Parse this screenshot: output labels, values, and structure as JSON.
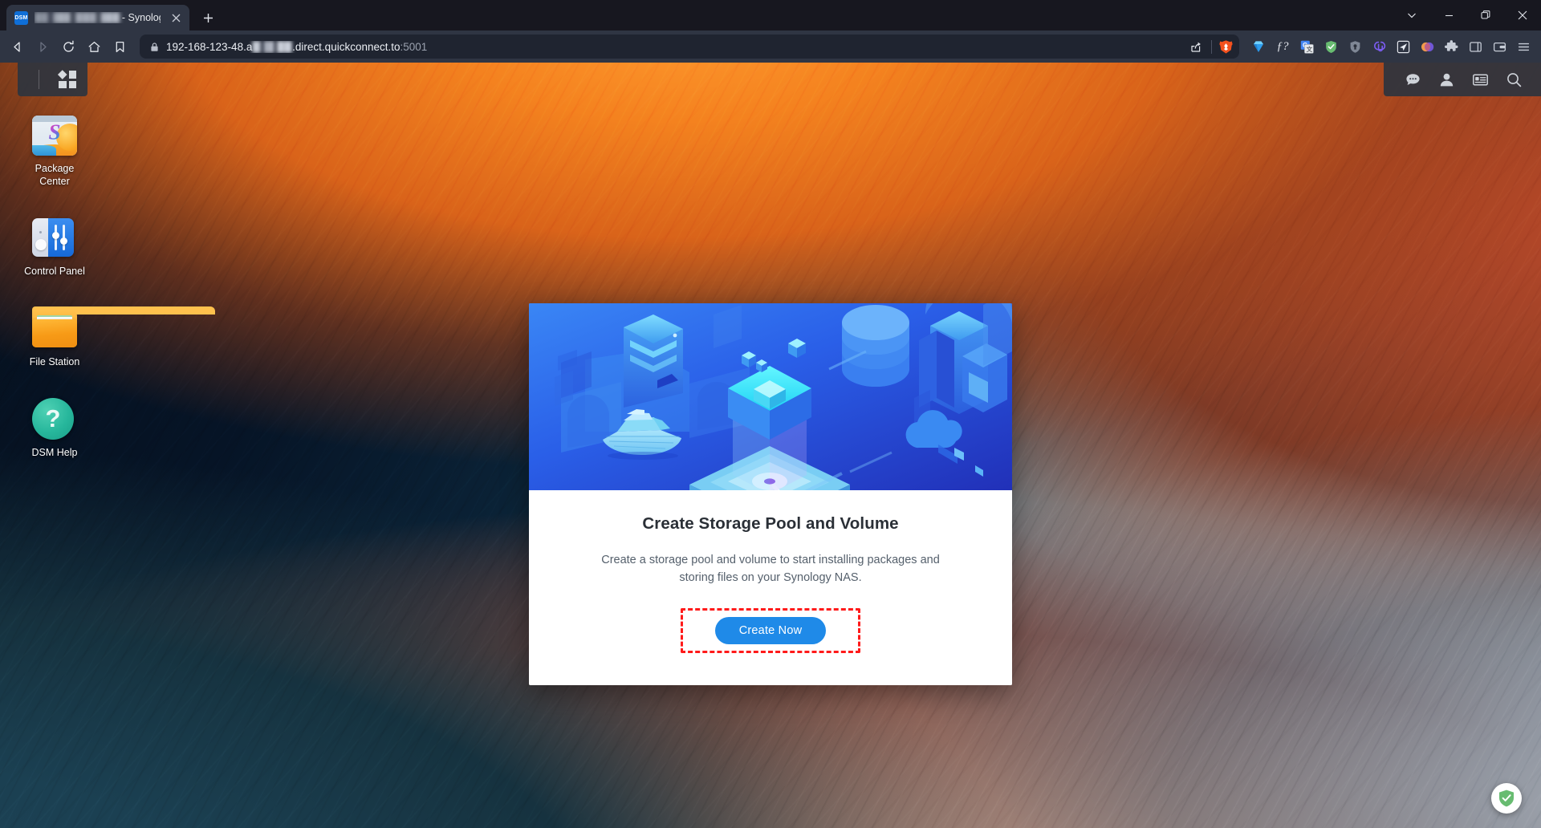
{
  "browser": {
    "tab": {
      "favicon_label": "DSM",
      "title_blurred": "█████ ██████",
      "title_suffix": "- Synology NAS",
      "close_icon": "close-icon"
    },
    "new_tab_label": "+",
    "window_controls": {
      "tab_search": "⌄",
      "minimize": "–",
      "maximize": "❐",
      "close": "✕"
    },
    "nav": {
      "back": "back-icon",
      "forward": "forward-icon",
      "reload": "reload-icon",
      "home": "home-icon",
      "bookmark": "bookmark-icon"
    },
    "address": {
      "lock": "lock-icon",
      "url_prefix": "192-168-123-48.a",
      "url_blurred": "█████",
      "url_suffix": ".direct.quickconnect.to",
      "port": ":5001",
      "share_icon": "share-icon",
      "brave_shields_icon": "brave-lion-icon"
    },
    "extensions": [
      {
        "name": "diamond-extension-icon",
        "color": "#3da9f5"
      },
      {
        "name": "fonts-ninja-extension-icon",
        "label": "ƒ?"
      },
      {
        "name": "google-translate-extension-icon",
        "color": "#4285f4"
      },
      {
        "name": "adguard-extension-icon",
        "color": "#68bc71"
      },
      {
        "name": "shield-extension-icon",
        "color": "#878d99"
      },
      {
        "name": "link-extension-icon",
        "color": "#7b5cf0"
      },
      {
        "name": "send-extension-icon",
        "color": "#e9edf3"
      },
      {
        "name": "color-picker-extension-icon",
        "color": "#f06a3c"
      },
      {
        "name": "puzzle-extensions-icon",
        "color": "#c6ccd6"
      },
      {
        "name": "sidebar-toggle-icon",
        "color": "#c6ccd6"
      },
      {
        "name": "wallet-icon",
        "color": "#c6ccd6"
      },
      {
        "name": "browser-menu-icon",
        "color": "#c6ccd6"
      }
    ]
  },
  "dsm": {
    "taskbar": {
      "main_menu_icon": "apps-grid-icon",
      "right_icons": [
        {
          "name": "notifications-icon"
        },
        {
          "name": "user-account-icon"
        },
        {
          "name": "widgets-icon"
        },
        {
          "name": "search-icon"
        }
      ]
    },
    "desktop_icons": [
      {
        "name": "package-center",
        "label": "Package\nCenter",
        "label_line1": "Package",
        "label_line2": "Center"
      },
      {
        "name": "control-panel",
        "label": "Control Panel",
        "label_line1": "Control Panel",
        "label_line2": ""
      },
      {
        "name": "file-station",
        "label": "File Station",
        "label_line1": "File Station",
        "label_line2": ""
      },
      {
        "name": "dsm-help",
        "label": "DSM Help",
        "label_line1": "DSM Help",
        "label_line2": "",
        "glyph": "?"
      }
    ],
    "dialog": {
      "hero_illustration": "isometric-storage-city-illustration",
      "title": "Create Storage Pool and Volume",
      "description": "Create a storage pool and volume to start installing packages and storing files on your Synology NAS.",
      "primary_button": "Create Now",
      "highlight_color": "#ff1a1a",
      "button_color": "#1f8ae8"
    }
  },
  "overlay": {
    "adguard_badge": "adguard-shield-badge"
  }
}
